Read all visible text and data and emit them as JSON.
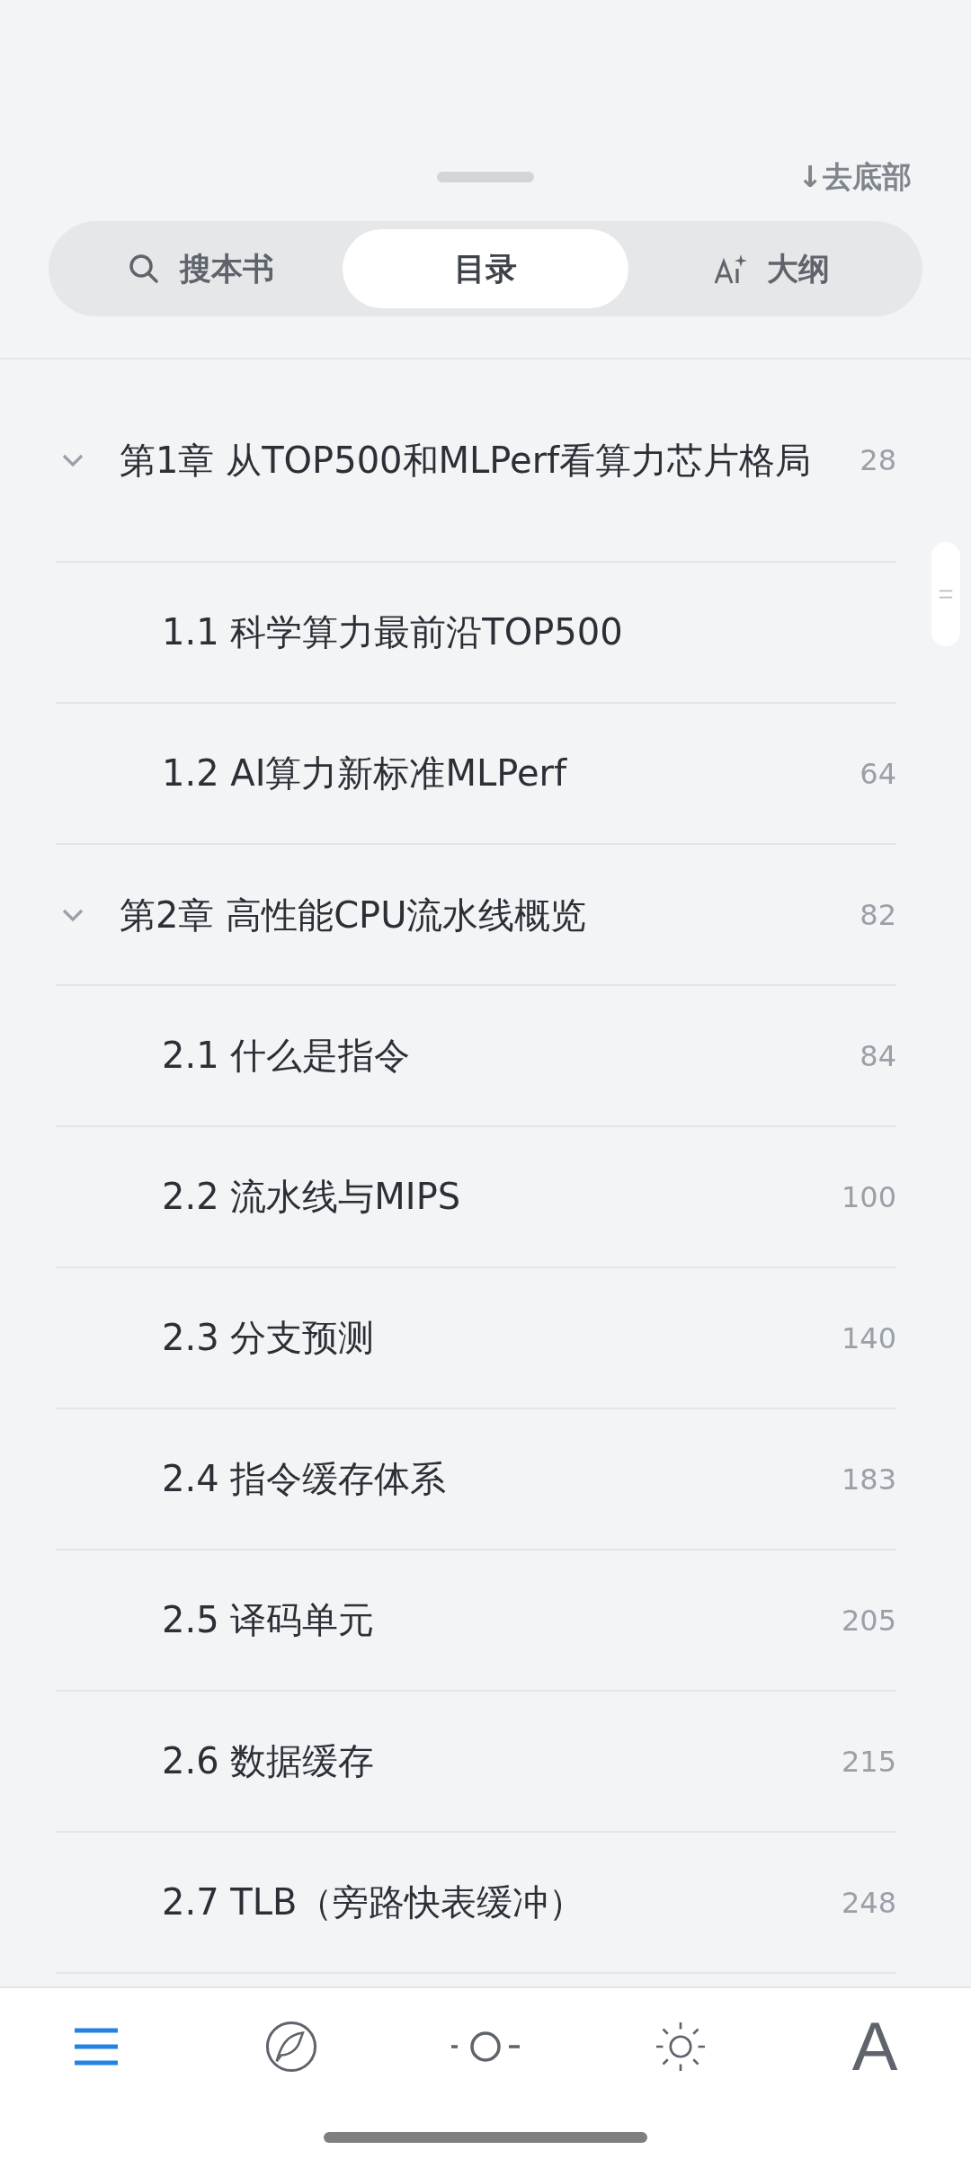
{
  "header": {
    "jump_link": "↓去底部"
  },
  "tabs": [
    {
      "kind": "search",
      "label": "搜本书",
      "selected": false
    },
    {
      "kind": "plain",
      "label": "目录",
      "selected": true
    },
    {
      "kind": "ai",
      "label": "大纲",
      "selected": false
    }
  ],
  "toc": [
    {
      "title": "第1章 从TOP500和MLPerf看算力芯片格局",
      "page": "28",
      "expanded": true,
      "children": [
        {
          "title": "1.1 科学算力最前沿TOP500"
        },
        {
          "title": "1.2 AI算力新标准MLPerf",
          "page": "64"
        }
      ]
    },
    {
      "title": "第2章 高性能CPU流水线概览",
      "page": "82",
      "expanded": true,
      "children": [
        {
          "title": "2.1 什么是指令",
          "page": "84"
        },
        {
          "title": "2.2 流水线与MIPS",
          "page": "100"
        },
        {
          "title": "2.3 分支预测",
          "page": "140"
        },
        {
          "title": "2.4 指令缓存体系",
          "page": "183"
        },
        {
          "title": "2.5 译码单元",
          "page": "205"
        },
        {
          "title": "2.6 数据缓存",
          "page": "215"
        },
        {
          "title": "2.7 TLB（旁路快表缓冲）",
          "page": "248"
        }
      ]
    }
  ],
  "bottom_bar": [
    {
      "kind": "menu",
      "selected": true
    },
    {
      "kind": "compass",
      "selected": false
    },
    {
      "kind": "dim",
      "selected": false
    },
    {
      "kind": "bright",
      "selected": false
    },
    {
      "kind": "font",
      "label": "A",
      "selected": false
    }
  ]
}
